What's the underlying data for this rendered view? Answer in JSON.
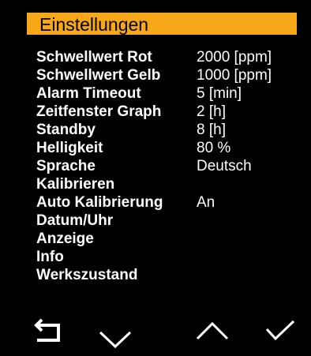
{
  "header": {
    "title": "Einstellungen"
  },
  "menu": {
    "items": [
      {
        "label": "Schwellwert Rot",
        "value": "2000 [ppm]"
      },
      {
        "label": "Schwellwert Gelb",
        "value": "1000 [ppm]"
      },
      {
        "label": "Alarm Timeout",
        "value": "5 [min]"
      },
      {
        "label": "Zeitfenster Graph",
        "value": "2 [h]"
      },
      {
        "label": "Standby",
        "value": "8 [h]"
      },
      {
        "label": "Helligkeit",
        "value": "80 %"
      },
      {
        "label": "Sprache",
        "value": "Deutsch"
      },
      {
        "label": "Kalibrieren",
        "value": ""
      },
      {
        "label": "Auto Kalibrierung",
        "value": "An"
      },
      {
        "label": "Datum/Uhr",
        "value": ""
      },
      {
        "label": "Anzeige",
        "value": ""
      },
      {
        "label": "Info",
        "value": ""
      },
      {
        "label": "Werkszustand",
        "value": ""
      }
    ]
  },
  "navigation": {
    "buttons": [
      {
        "icon": "back-arrow-icon"
      },
      {
        "icon": "chevron-down-icon"
      },
      {
        "icon": "chevron-up-icon"
      },
      {
        "icon": "checkmark-icon"
      }
    ]
  },
  "colors": {
    "background": "#000000",
    "title_bar": "#f7a818",
    "title_text": "#000000",
    "text": "#ffffff"
  }
}
